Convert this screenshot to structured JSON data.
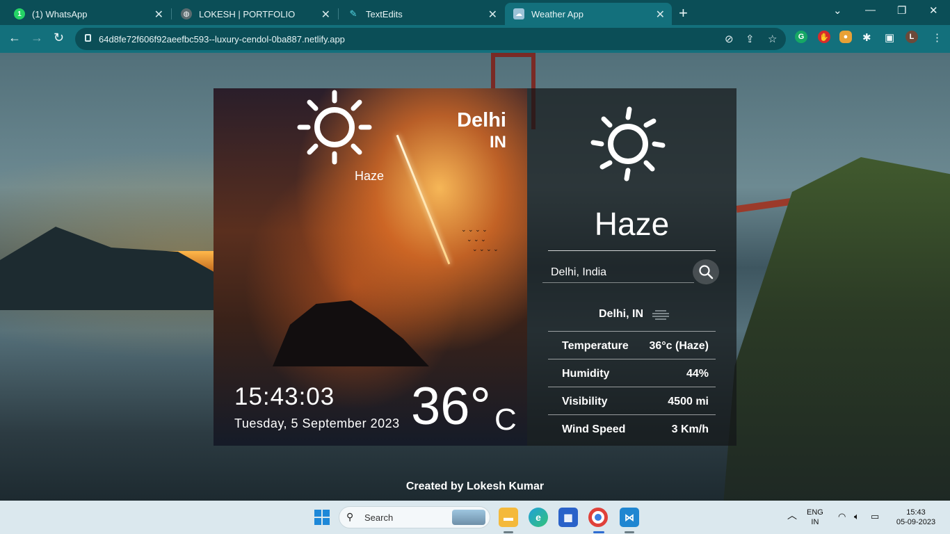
{
  "browser": {
    "tabs": [
      {
        "title": "(1) WhatsApp",
        "icon": "whatsapp-icon"
      },
      {
        "title": "LOKESH | PORTFOLIO",
        "icon": "globe-icon"
      },
      {
        "title": "TextEdits",
        "icon": "pen-icon"
      },
      {
        "title": "Weather App",
        "icon": "weather-app-icon",
        "active": true
      }
    ],
    "whatsapp_badge": "1",
    "url": "64d8fe72f606f92aeefbc593--luxury-cendol-0ba887.netlify.app"
  },
  "weather": {
    "left": {
      "condition": "Haze",
      "city": "Delhi",
      "country": "IN",
      "time": "15:43:03",
      "date": "Tuesday, 5 September 2023",
      "temperature": "36°",
      "unit": "C"
    },
    "right": {
      "condition": "Haze",
      "search_value": "Delhi, India",
      "location": "Delhi, IN",
      "details": [
        {
          "label": "Temperature",
          "value": "36°c (Haze)"
        },
        {
          "label": "Humidity",
          "value": "44%"
        },
        {
          "label": "Visibility",
          "value": "4500 mi"
        },
        {
          "label": "Wind Speed",
          "value": "3 Km/h"
        }
      ]
    },
    "credit": "Created by Lokesh Kumar"
  },
  "taskbar": {
    "search_placeholder": "Search",
    "language": "ENG",
    "region": "IN",
    "time": "15:43",
    "date": "05-09-2023"
  }
}
